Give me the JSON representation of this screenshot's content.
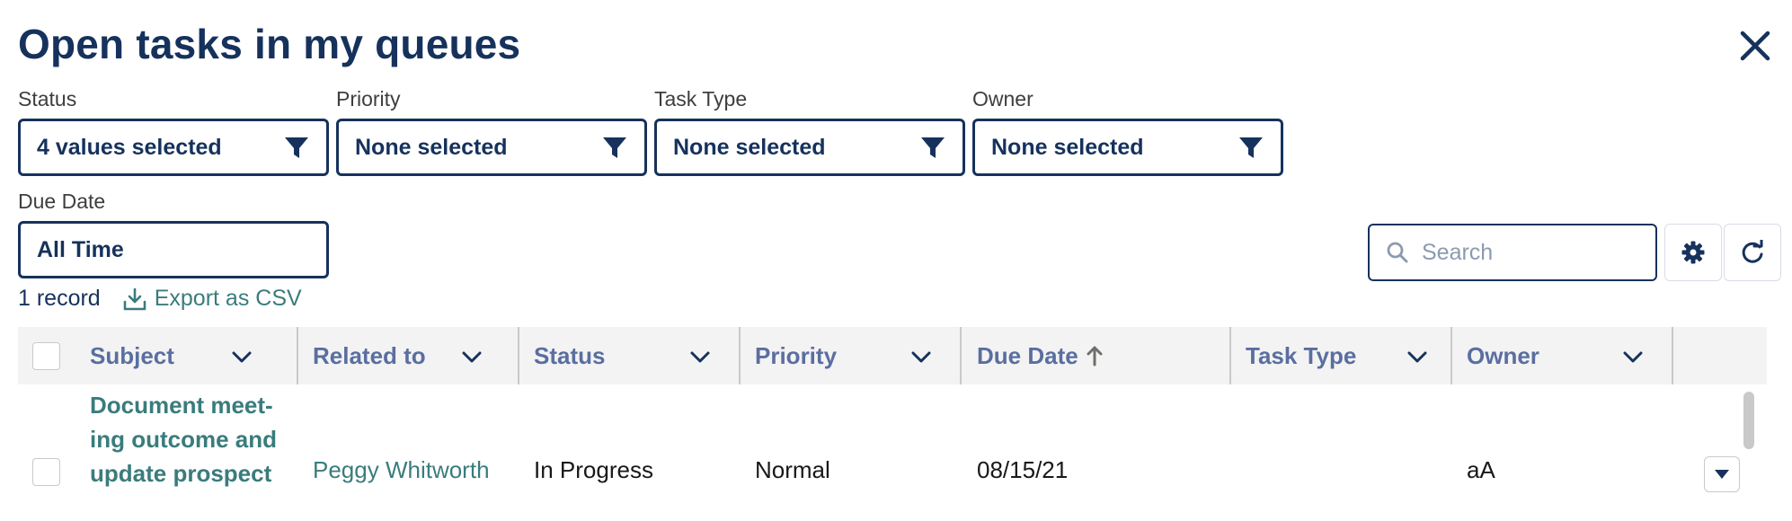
{
  "title": "Open tasks in my queues",
  "filters": [
    {
      "label": "Status",
      "value": "4 values selected"
    },
    {
      "label": "Priority",
      "value": "None selected"
    },
    {
      "label": "Task Type",
      "value": "None selected"
    },
    {
      "label": "Owner",
      "value": "None selected"
    }
  ],
  "due_date_filter": {
    "label": "Due Date",
    "value": "All Time"
  },
  "record_count": "1 record",
  "export_label": "Export as CSV",
  "search": {
    "placeholder": "Search"
  },
  "table": {
    "columns": [
      "Subject",
      "Related to",
      "Status",
      "Priority",
      "Due Date",
      "Task Type",
      "Owner"
    ],
    "rows": [
      {
        "subject": "Document meet-ing outcome and update prospect",
        "related_to": "Peggy Whitworth",
        "status": "In Progress",
        "priority": "Normal",
        "due_date": "08/15/21",
        "task_type": "",
        "owner": "aA"
      }
    ]
  },
  "colors": {
    "navy": "#16325c",
    "teal_link": "#3a7c7c",
    "header_bg": "#f3f3f3"
  },
  "icons": [
    "close-icon",
    "filter-icon",
    "download-icon",
    "search-icon",
    "gear-icon",
    "refresh-icon",
    "chevron-down-icon",
    "arrow-up-icon",
    "caret-down-icon"
  ]
}
